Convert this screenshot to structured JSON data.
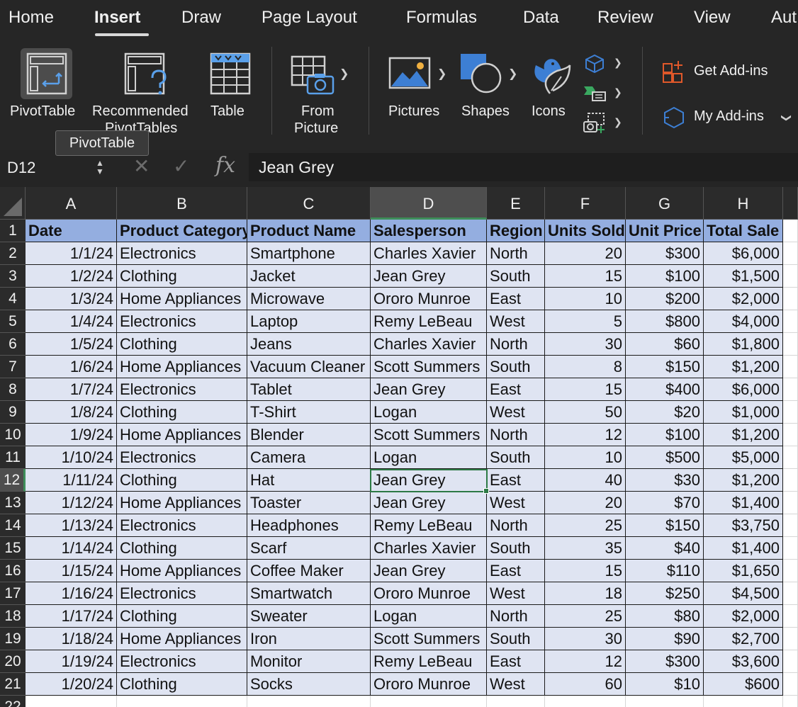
{
  "ribbon_tabs": [
    "Home",
    "Insert",
    "Draw",
    "Page Layout",
    "Formulas",
    "Data",
    "Review",
    "View",
    "Aut"
  ],
  "active_tab": "Insert",
  "ribbon": {
    "pivottable": "PivotTable",
    "recommended_line1": "Recommended",
    "recommended_line2": "PivotTables",
    "table": "Table",
    "from_picture_line1": "From",
    "from_picture_line2": "Picture",
    "pictures": "Pictures",
    "shapes": "Shapes",
    "icons": "Icons",
    "get_addins": "Get Add-ins",
    "my_addins": "My Add-ins"
  },
  "tooltip": "PivotTable",
  "formula_bar": {
    "name_box": "D12",
    "fx_label": "fx",
    "formula": "Jean Grey"
  },
  "grid": {
    "columns": [
      "A",
      "B",
      "C",
      "D",
      "E",
      "F",
      "G",
      "H"
    ],
    "selected_column": "D",
    "selected_row": 12,
    "header_row": [
      "Date",
      "Product Category",
      "Product Name",
      "Salesperson",
      "Region",
      "Units Sold",
      "Unit Price",
      "Total Sale"
    ],
    "rows": [
      [
        "1/1/24",
        "Electronics",
        "Smartphone",
        "Charles Xavier",
        "North",
        "20",
        "$300",
        "$6,000"
      ],
      [
        "1/2/24",
        "Clothing",
        "Jacket",
        "Jean Grey",
        "South",
        "15",
        "$100",
        "$1,500"
      ],
      [
        "1/3/24",
        "Home Appliances",
        "Microwave",
        "Ororo Munroe",
        "East",
        "10",
        "$200",
        "$2,000"
      ],
      [
        "1/4/24",
        "Electronics",
        "Laptop",
        "Remy LeBeau",
        "West",
        "5",
        "$800",
        "$4,000"
      ],
      [
        "1/5/24",
        "Clothing",
        "Jeans",
        "Charles Xavier",
        "North",
        "30",
        "$60",
        "$1,800"
      ],
      [
        "1/6/24",
        "Home Appliances",
        "Vacuum Cleaner",
        "Scott Summers",
        "South",
        "8",
        "$150",
        "$1,200"
      ],
      [
        "1/7/24",
        "Electronics",
        "Tablet",
        "Jean Grey",
        "East",
        "15",
        "$400",
        "$6,000"
      ],
      [
        "1/8/24",
        "Clothing",
        "T-Shirt",
        "Logan",
        "West",
        "50",
        "$20",
        "$1,000"
      ],
      [
        "1/9/24",
        "Home Appliances",
        "Blender",
        "Scott Summers",
        "North",
        "12",
        "$100",
        "$1,200"
      ],
      [
        "1/10/24",
        "Electronics",
        "Camera",
        "Logan",
        "South",
        "10",
        "$500",
        "$5,000"
      ],
      [
        "1/11/24",
        "Clothing",
        "Hat",
        "Jean Grey",
        "East",
        "40",
        "$30",
        "$1,200"
      ],
      [
        "1/12/24",
        "Home Appliances",
        "Toaster",
        "Jean Grey",
        "West",
        "20",
        "$70",
        "$1,400"
      ],
      [
        "1/13/24",
        "Electronics",
        "Headphones",
        "Remy LeBeau",
        "North",
        "25",
        "$150",
        "$3,750"
      ],
      [
        "1/14/24",
        "Clothing",
        "Scarf",
        "Charles Xavier",
        "South",
        "35",
        "$40",
        "$1,400"
      ],
      [
        "1/15/24",
        "Home Appliances",
        "Coffee Maker",
        "Jean Grey",
        "East",
        "15",
        "$110",
        "$1,650"
      ],
      [
        "1/16/24",
        "Electronics",
        "Smartwatch",
        "Ororo Munroe",
        "West",
        "18",
        "$250",
        "$4,500"
      ],
      [
        "1/17/24",
        "Clothing",
        "Sweater",
        "Logan",
        "North",
        "25",
        "$80",
        "$2,000"
      ],
      [
        "1/18/24",
        "Home Appliances",
        "Iron",
        "Scott Summers",
        "South",
        "30",
        "$90",
        "$2,700"
      ],
      [
        "1/19/24",
        "Electronics",
        "Monitor",
        "Remy LeBeau",
        "East",
        "12",
        "$300",
        "$3,600"
      ],
      [
        "1/20/24",
        "Clothing",
        "Socks",
        "Ororo Munroe",
        "West",
        "60",
        "$10",
        "$600"
      ]
    ]
  },
  "colors": {
    "header_fill": "#94aee0",
    "band_fill": "#dfe4f2",
    "selection_green": "#2d7a45",
    "ribbon_bg": "#262626"
  }
}
